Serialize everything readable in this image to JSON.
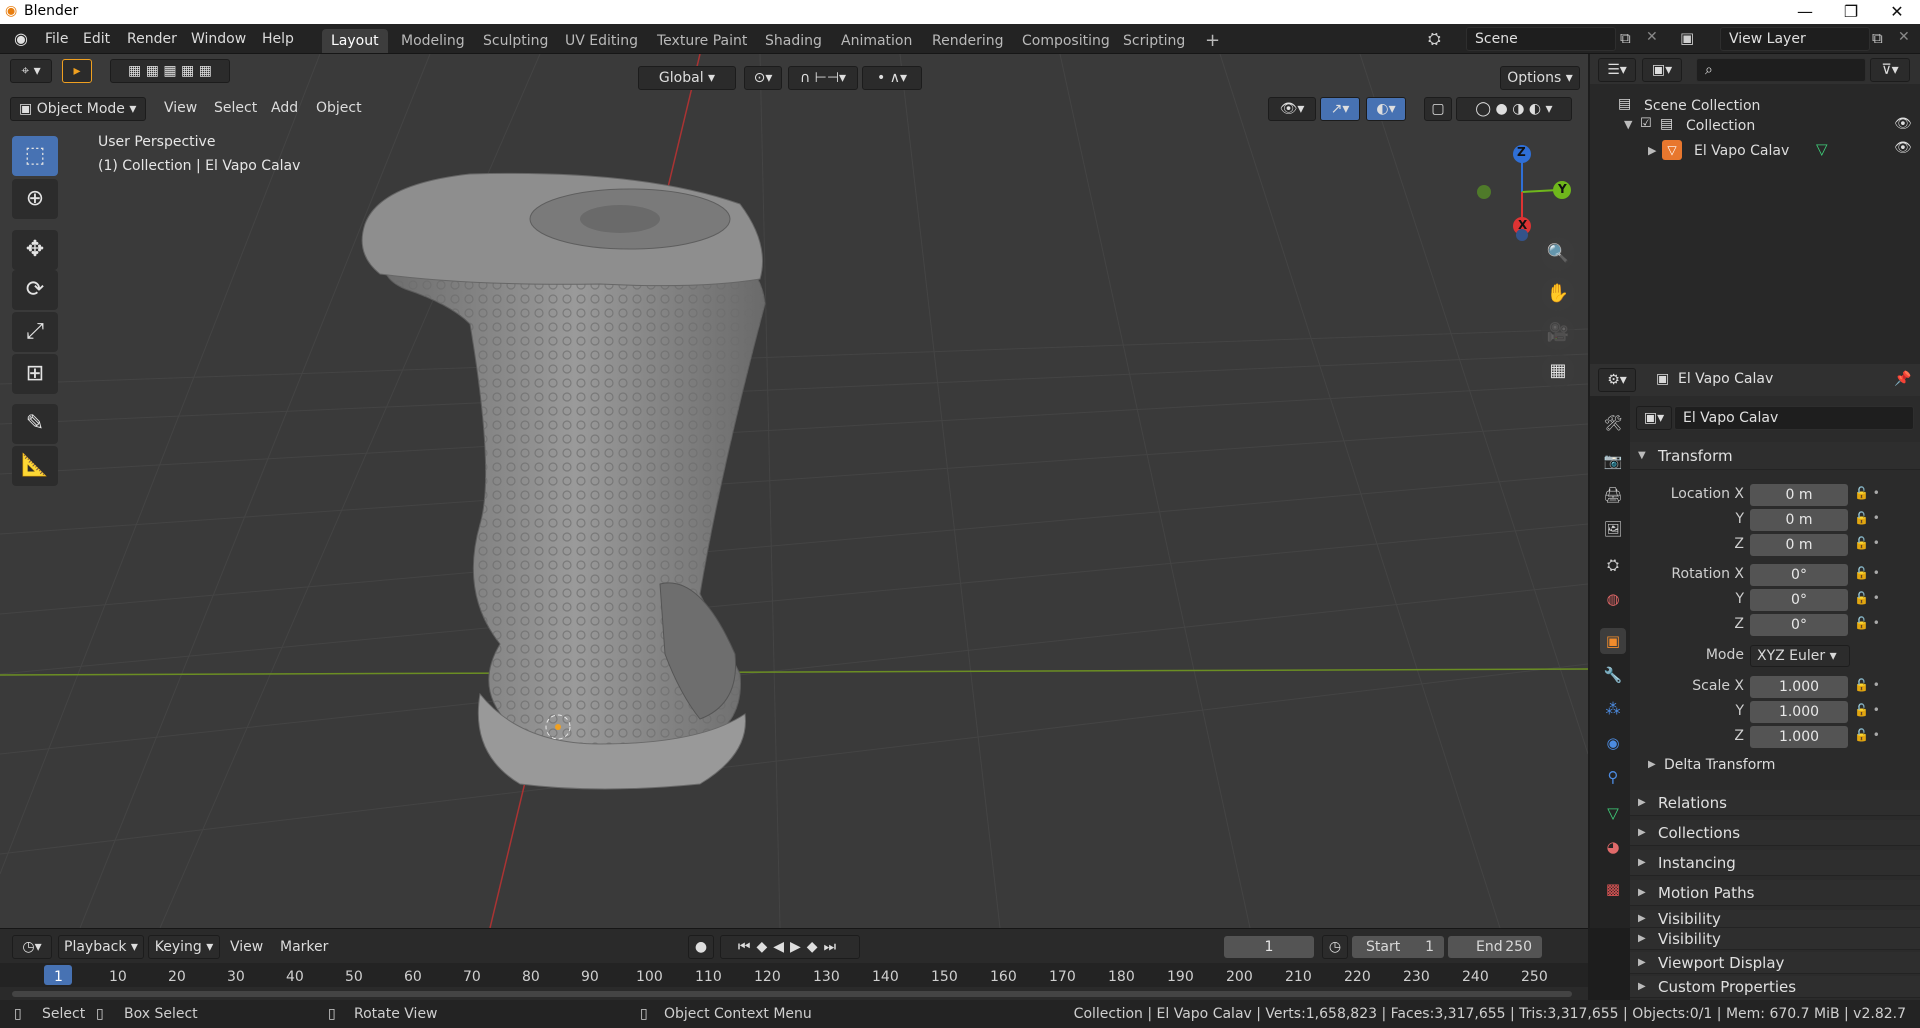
{
  "window": {
    "title": "Blender",
    "minimize": "—",
    "restore": "❐",
    "close": "✕"
  },
  "menu": [
    "File",
    "Edit",
    "Render",
    "Window",
    "Help"
  ],
  "workspaces": [
    "Layout",
    "Modeling",
    "Sculpting",
    "UV Editing",
    "Texture Paint",
    "Shading",
    "Animation",
    "Rendering",
    "Compositing",
    "Scripting"
  ],
  "workspace_add": "+",
  "scene": {
    "name": "Scene",
    "view_layer": "View Layer"
  },
  "viewport": {
    "orientation": "Global",
    "options": "Options",
    "mode": "Object Mode",
    "header_menus": [
      "View",
      "Select",
      "Add",
      "Object"
    ],
    "overlay_line1": "User Perspective",
    "overlay_line2": "(1) Collection | El Vapo Calav",
    "gizmo": {
      "z": "Z",
      "y": "Y",
      "x": "X"
    },
    "accent": "#4772b3"
  },
  "outliner": {
    "root": "Scene Collection",
    "collection": "Collection",
    "object": "El Vapo Calav"
  },
  "properties": {
    "header_name": "El Vapo Calav",
    "object_name": "El Vapo Calav",
    "transform_label": "Transform",
    "location_label": "Location X",
    "rotation_label": "Rotation X",
    "scale_label": "Scale X",
    "y_label": "Y",
    "z_label": "Z",
    "location": [
      "0 m",
      "0 m",
      "0 m"
    ],
    "rotation": [
      "0°",
      "0°",
      "0°"
    ],
    "mode_label": "Mode",
    "mode_value": "XYZ Euler",
    "scale": [
      "1.000",
      "1.000",
      "1.000"
    ],
    "delta": "Delta Transform",
    "panels": [
      "Relations",
      "Collections",
      "Instancing",
      "Motion Paths",
      "Visibility",
      "Viewport Display",
      "Custom Properties"
    ]
  },
  "timeline": {
    "menus": [
      "Playback",
      "Keying",
      "View",
      "Marker"
    ],
    "current_frame": "1",
    "start_label": "Start",
    "start": "1",
    "end_label": "End",
    "end": "250",
    "ticks": [
      "1",
      "10",
      "20",
      "30",
      "40",
      "50",
      "60",
      "70",
      "80",
      "90",
      "100",
      "110",
      "120",
      "130",
      "140",
      "150",
      "160",
      "170",
      "180",
      "190",
      "200",
      "210",
      "220",
      "230",
      "240",
      "250"
    ]
  },
  "status": {
    "select": "Select",
    "box_select": "Box Select",
    "rotate_view": "Rotate View",
    "context_menu": "Object Context Menu",
    "stats": "Collection | El Vapo Calav | Verts:1,658,823 | Faces:3,317,655 | Tris:3,317,655 | Objects:0/1 | Mem: 670.7 MiB | v2.82.7"
  }
}
